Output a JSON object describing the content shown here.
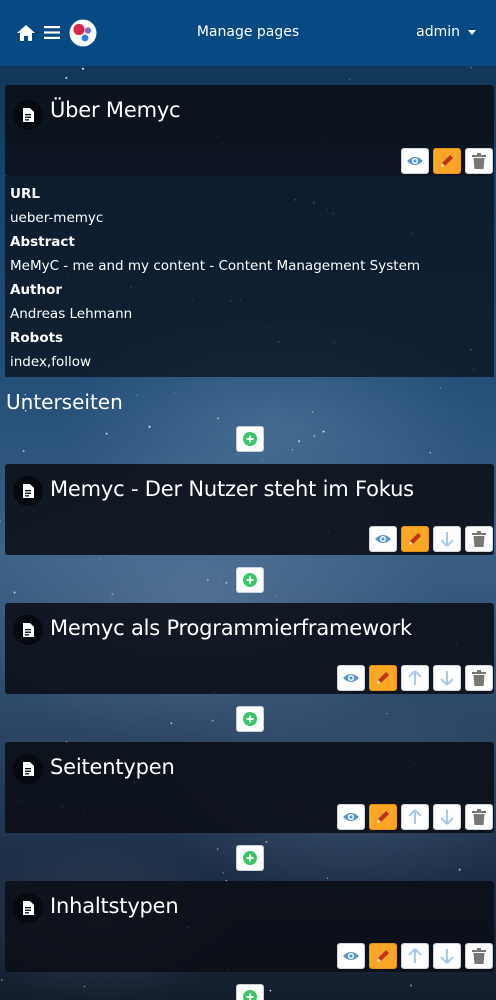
{
  "navbar": {
    "home_icon": "home-icon",
    "menu_icon": "hamburger-icon",
    "logo_icon": "memyc-logo-icon",
    "title": "Manage pages",
    "user": "admin"
  },
  "page": {
    "title": "Über Memyc",
    "url_label": "URL",
    "url": "ueber-memyc",
    "abstract_label": "Abstract",
    "abstract": "MeMyC - me and my content - Content Management System",
    "author_label": "Author",
    "author": "Andreas Lehmann",
    "robots_label": "Robots",
    "robots": "index,follow",
    "actions": [
      "view-icon",
      "edit-icon",
      "delete-icon"
    ]
  },
  "subpages_title": "Unterseiten",
  "subpages": [
    {
      "title": "Memyc - Der Nutzer steht im Fokus",
      "actions": [
        "view-icon",
        "edit-icon",
        "move-down-icon",
        "delete-icon"
      ]
    },
    {
      "title": "Memyc als Programmierframework",
      "actions": [
        "view-icon",
        "edit-icon",
        "move-up-icon",
        "move-down-icon",
        "delete-icon"
      ]
    },
    {
      "title": "Seitentypen",
      "actions": [
        "view-icon",
        "edit-icon",
        "move-up-icon",
        "move-down-icon",
        "delete-icon"
      ]
    },
    {
      "title": "Inhaltstypen",
      "actions": [
        "view-icon",
        "edit-icon",
        "move-up-icon",
        "move-down-icon",
        "delete-icon"
      ]
    }
  ],
  "colors": {
    "navbar": "#074a83",
    "edit_button": "#fba625",
    "add_icon": "#3cc46b",
    "view_icon": "#5b95cf",
    "move_icon": "#a9c9ea",
    "delete_icon": "#777777"
  }
}
